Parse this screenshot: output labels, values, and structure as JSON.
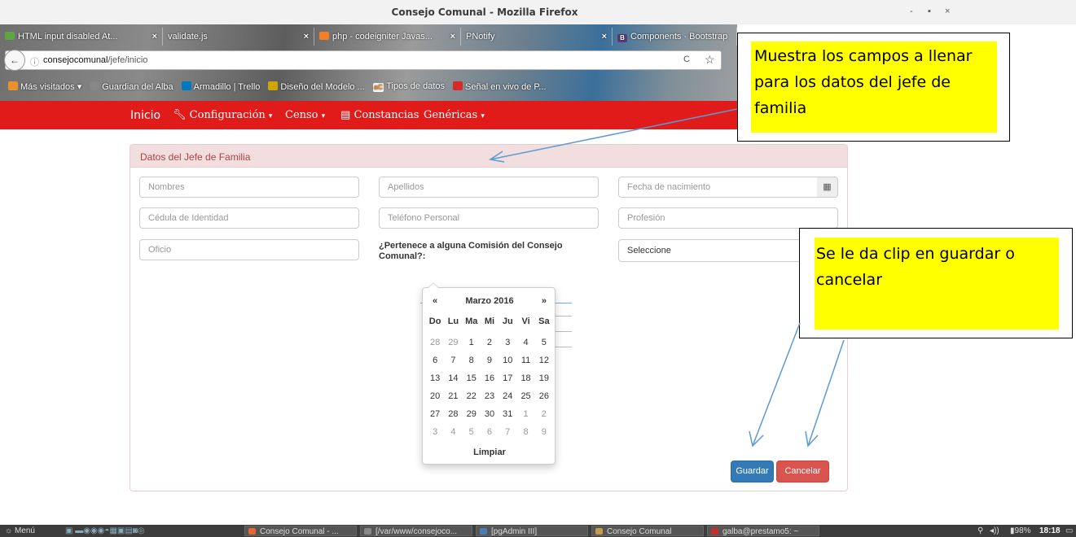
{
  "window": {
    "title": "Consejo Comunal - Mozilla Firefox",
    "controls": [
      "-",
      "▪",
      "×"
    ]
  },
  "tabs": [
    {
      "label": "HTML input disabled At...",
      "close": "×",
      "color": "#5fa540"
    },
    {
      "label": "validate.js",
      "close": "×",
      "color": ""
    },
    {
      "label": "php - codeigniter Javas...",
      "close": "×",
      "color": "#f48024"
    },
    {
      "label": "PNotify",
      "close": "×",
      "color": ""
    },
    {
      "label": "Components · Bootstrap",
      "close": "",
      "color": "#563d7c",
      "badge": "B"
    }
  ],
  "url": {
    "host": "consejocomunal",
    "path": "/jefe/inicio"
  },
  "bookmarks": [
    {
      "label": "Más visitados",
      "color": "#e8922e"
    },
    {
      "label": "Guardian del Alba",
      "color": "#888888"
    },
    {
      "label": "Armadillo | Trello",
      "color": "#0079bf"
    },
    {
      "label": "Diseño del Modelo ...",
      "color": "#cfa600"
    },
    {
      "label": "Tipos de datos",
      "color": "#e8922e",
      "badge": "aC"
    },
    {
      "label": "Señal en vivo de P...",
      "color": "#d42a2a"
    }
  ],
  "navbar": {
    "brand": "Inicio",
    "configuracion": "Configuración",
    "censo": "Censo",
    "constancias": "Constancias",
    "genericas": "Genéricas",
    "caret": "▾"
  },
  "panel": {
    "title": "Datos del Jefe de Familia"
  },
  "form": {
    "nombres": "Nombres",
    "apellidos": "Apellidos",
    "fecha": "Fecha de nacimiento",
    "cedula": "Cédula de Identidad",
    "telefono": "Teléfono Personal",
    "profesion": "Profesión",
    "oficio": "Oficio",
    "comision_label": "¿Pertenece a alguna Comisión del Consejo Comunal?:",
    "select_value": "Seleccione"
  },
  "datepicker": {
    "prev": "«",
    "next": "»",
    "month": "Marzo 2016",
    "dow": [
      "Do",
      "Lu",
      "Ma",
      "Mi",
      "Ju",
      "Vi",
      "Sa"
    ],
    "days": [
      {
        "d": "28",
        "old": true
      },
      {
        "d": "29",
        "old": true
      },
      {
        "d": "1"
      },
      {
        "d": "2"
      },
      {
        "d": "3"
      },
      {
        "d": "4"
      },
      {
        "d": "5"
      },
      {
        "d": "6"
      },
      {
        "d": "7"
      },
      {
        "d": "8"
      },
      {
        "d": "9"
      },
      {
        "d": "10"
      },
      {
        "d": "11"
      },
      {
        "d": "12"
      },
      {
        "d": "13"
      },
      {
        "d": "14"
      },
      {
        "d": "15"
      },
      {
        "d": "16"
      },
      {
        "d": "17"
      },
      {
        "d": "18"
      },
      {
        "d": "19"
      },
      {
        "d": "20"
      },
      {
        "d": "21"
      },
      {
        "d": "22"
      },
      {
        "d": "23"
      },
      {
        "d": "24"
      },
      {
        "d": "25"
      },
      {
        "d": "26"
      },
      {
        "d": "27"
      },
      {
        "d": "28"
      },
      {
        "d": "29"
      },
      {
        "d": "30"
      },
      {
        "d": "31"
      },
      {
        "d": "1",
        "old": true
      },
      {
        "d": "2",
        "old": true
      },
      {
        "d": "3",
        "old": true
      },
      {
        "d": "4",
        "old": true
      },
      {
        "d": "5",
        "old": true
      },
      {
        "d": "6",
        "old": true
      },
      {
        "d": "7",
        "old": true
      },
      {
        "d": "8",
        "old": true
      },
      {
        "d": "9",
        "old": true
      }
    ],
    "clear": "Limpiar"
  },
  "buttons": {
    "guardar": "Guardar",
    "cancelar": "Cancelar"
  },
  "callouts": {
    "one": "Muestra los campos a llenar para los datos del jefe de familia",
    "two": "Se le da clip en guardar o cancelar"
  },
  "taskbar": {
    "menu": "Menú",
    "windows": [
      {
        "label": "Consejo Comunal - ...",
        "color": "#e8672a"
      },
      {
        "label": "[/var/www/consejoco...",
        "color": "#888888"
      },
      {
        "label": "[pgAdmin III]",
        "color": "#4a7db5"
      },
      {
        "label": "Consejo Comunal",
        "color": "#c79a4a"
      },
      {
        "label": "galba@prestamo5: ~",
        "color": "#cc2b2b"
      }
    ],
    "battery": "98%",
    "clock": "18:18"
  }
}
